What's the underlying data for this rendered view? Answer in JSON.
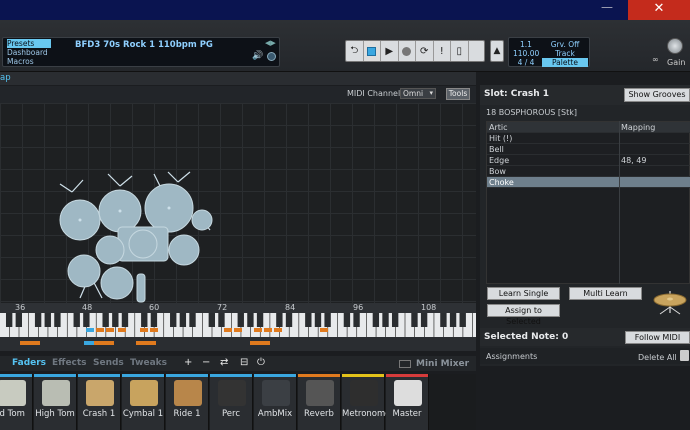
{
  "window": {
    "minimize_icon": "—",
    "maximize_icon": "☐",
    "close_icon": "✕"
  },
  "toolbar": {
    "nav": [
      "Presets",
      "Dashboard",
      "Macros"
    ],
    "preset_name": "BFD3 70s Rock 1 110bpm PG",
    "transport_icons": [
      "loop-icon",
      "stop-icon",
      "play-icon",
      "record-icon",
      "refresh-icon",
      "alert-icon",
      "metronome-icon"
    ],
    "info_left": [
      "1.1",
      "110.00",
      "4 / 4"
    ],
    "info_right": [
      "Grv. Off",
      "Track",
      "Palette"
    ],
    "infinity": "∞",
    "gain_label": "Gain"
  },
  "view": {
    "title": "ap",
    "midi_channel_label": "MIDI Channel",
    "midi_channel_value": "Omni",
    "tools_label": "Tools"
  },
  "keyboard": {
    "numbers": [
      "36",
      "48",
      "60",
      "72",
      "84",
      "96",
      "108"
    ]
  },
  "faders": {
    "tabs": [
      "Faders",
      "Effects",
      "Sends",
      "Tweaks"
    ],
    "icons": [
      "+",
      "−",
      "⇄",
      "⊟",
      "⏻"
    ],
    "mini_mixer": "Mini Mixer",
    "strips": [
      {
        "label": "id Tom",
        "color": "#c8cbc0"
      },
      {
        "label": "High Tom",
        "color": "#b9bdb3"
      },
      {
        "label": "Crash 1",
        "color": "#c9a66b"
      },
      {
        "label": "Cymbal 1",
        "color": "#c8a35e"
      },
      {
        "label": "Ride 1",
        "color": "#b8864a"
      },
      {
        "label": "Perc",
        "color": "#333"
      },
      {
        "label": "AmbMix",
        "color": "#3b3f44"
      },
      {
        "label": "Reverb",
        "color": "#555"
      },
      {
        "label": "Metronome",
        "color": "#2e2e2e"
      },
      {
        "label": "Master",
        "color": "#ddd"
      }
    ],
    "strip_bar_colors": [
      "#3aa7e0",
      "#3aa7e0",
      "#3aa7e0",
      "#3aa7e0",
      "#3aa7e0",
      "#3aa7e0",
      "#3aa7e0",
      "#e07a1e",
      "#e2c21a",
      "#d63b3b"
    ]
  },
  "slot": {
    "title": "Slot:  Crash 1",
    "show_grooves": "Show Grooves",
    "kitpiece": "18 BOSPHOROUS [Stk]",
    "columns": [
      "Artic",
      "Mapping"
    ],
    "articulations": [
      {
        "name": "Hit (!)",
        "mapping": ""
      },
      {
        "name": "Bell",
        "mapping": ""
      },
      {
        "name": "Edge",
        "mapping": "48, 49"
      },
      {
        "name": "Bow",
        "mapping": ""
      },
      {
        "name": "Choke",
        "mapping": ""
      }
    ],
    "selected_row": "Choke",
    "learn_single": "Learn Single",
    "multi_learn": "Multi Learn",
    "assign_to_selected": "Assign to Selected"
  },
  "selected_note": {
    "title": "Selected Note:  0",
    "follow_midi": "Follow MIDI",
    "assignments": "Assignments",
    "delete_all": "Delete All"
  }
}
